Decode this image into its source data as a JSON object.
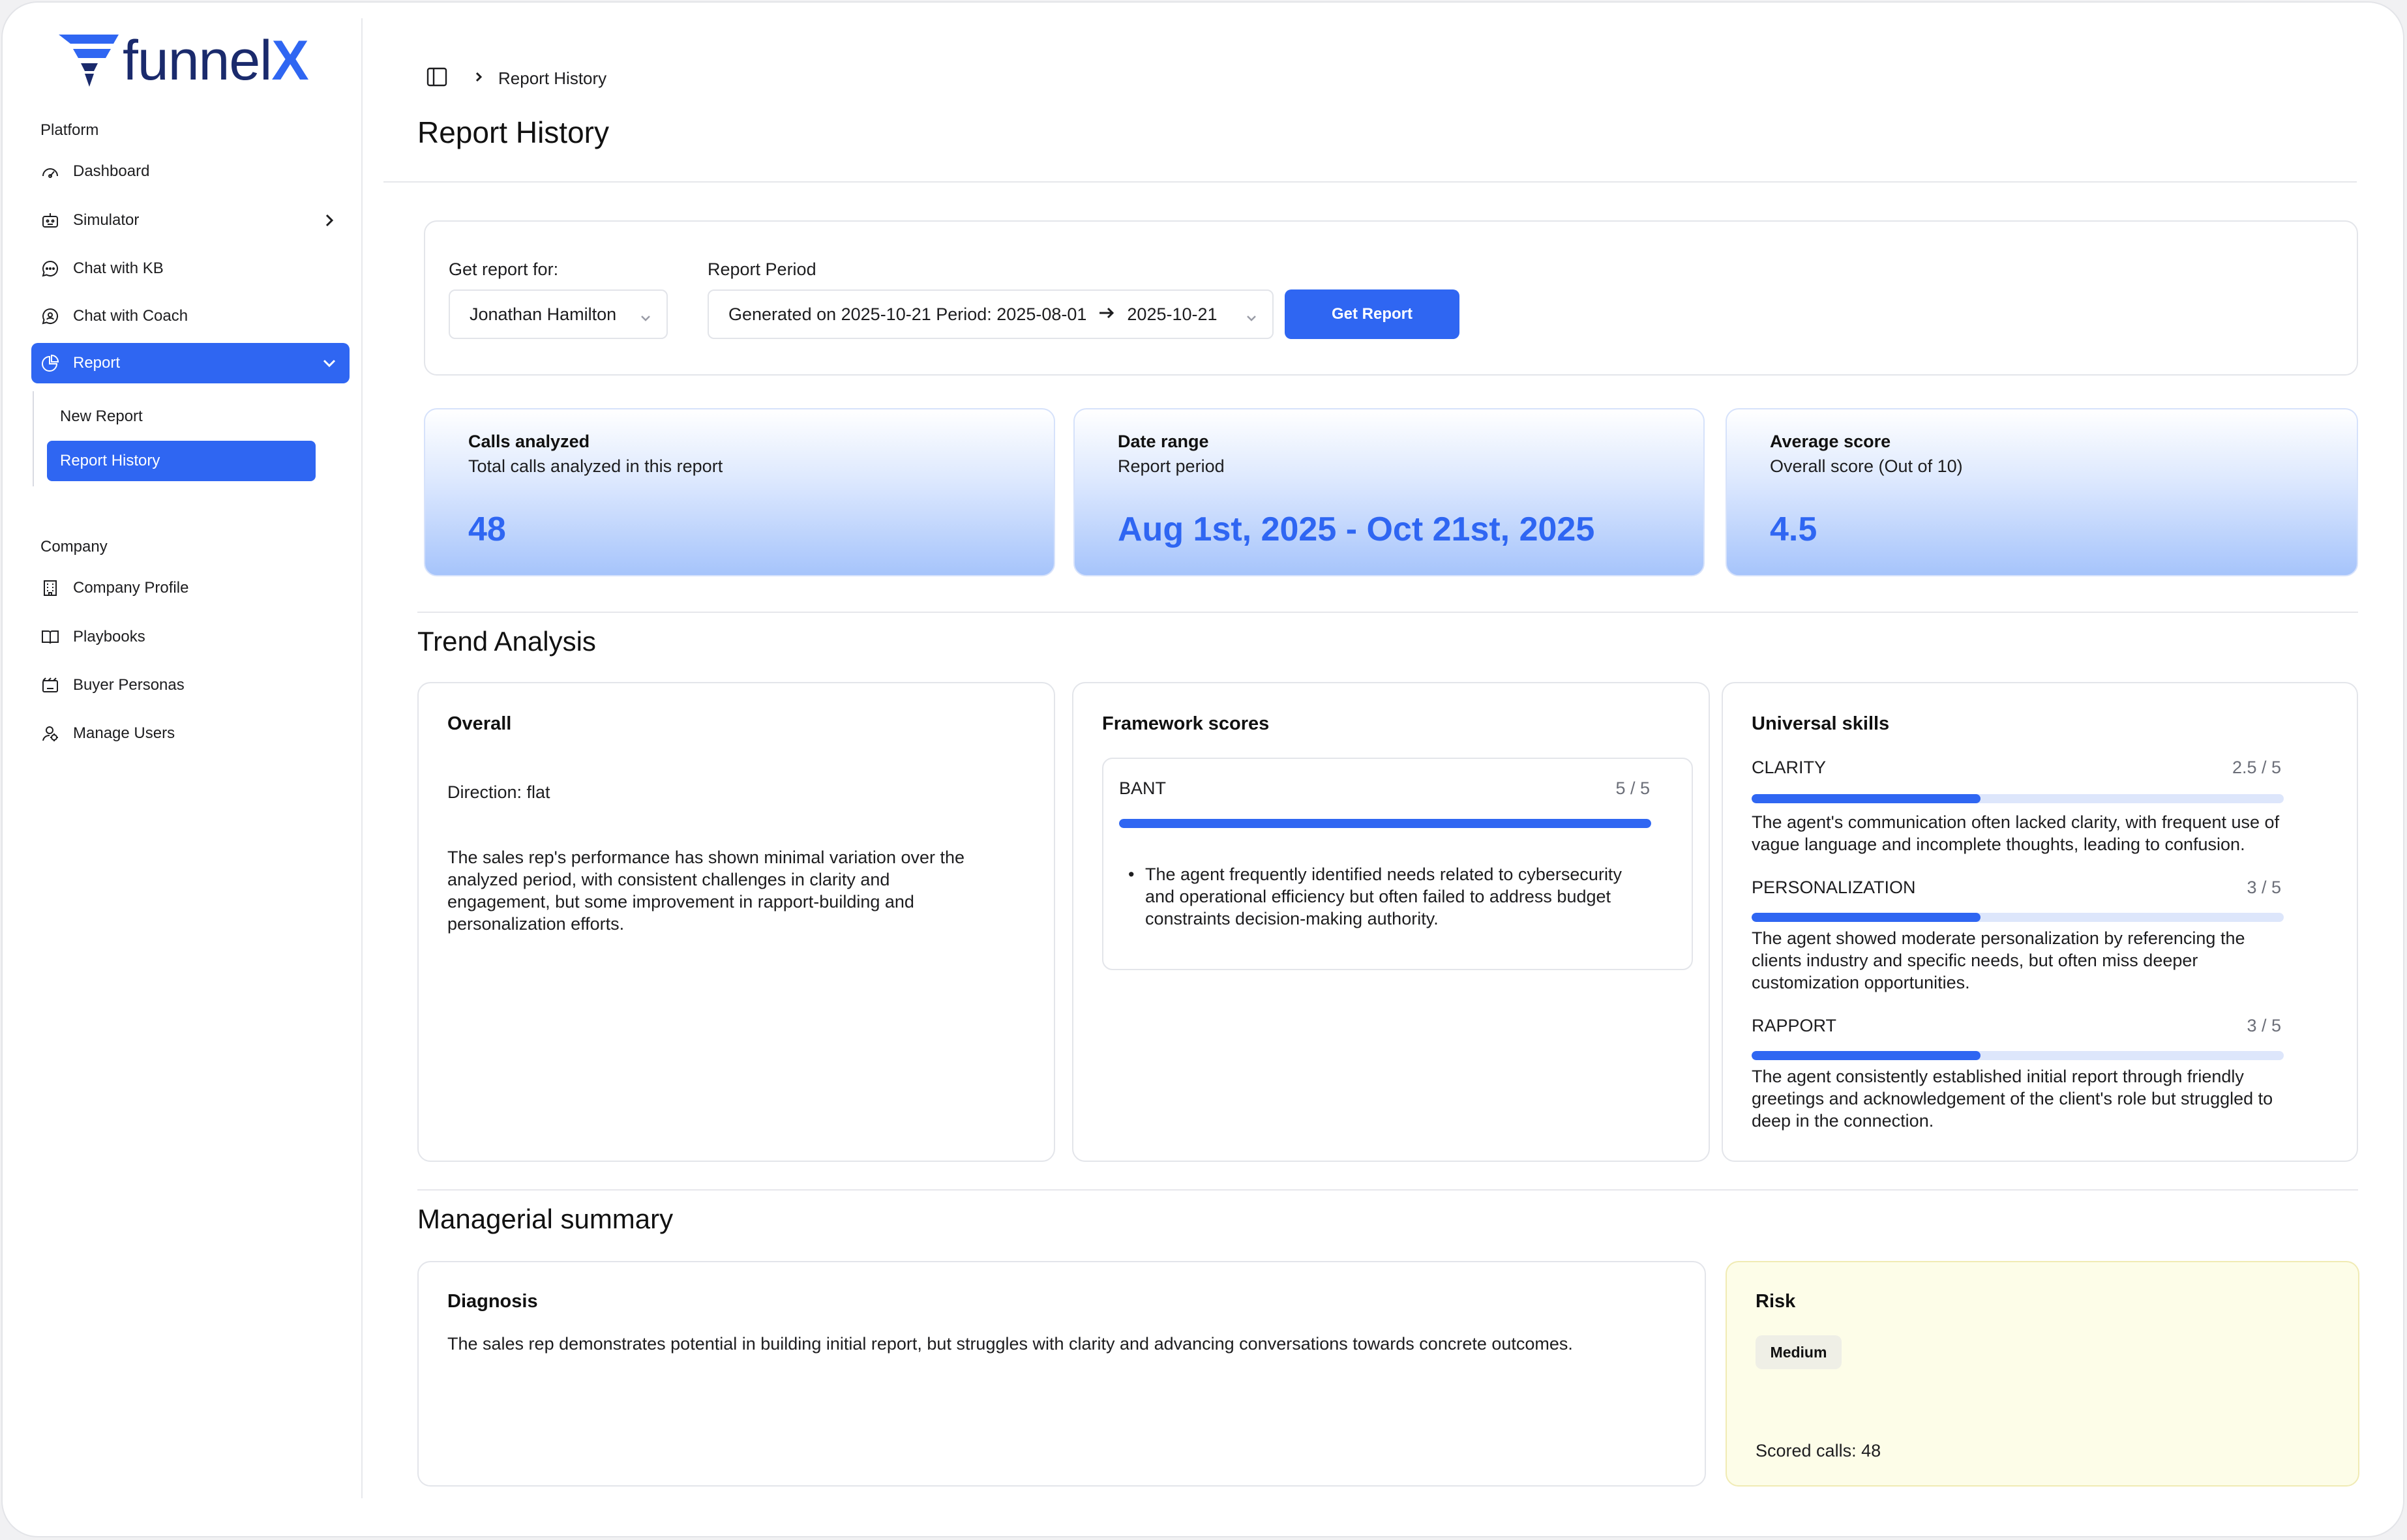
{
  "brand": {
    "name_main": "funnel",
    "name_accent": "X",
    "accent_color": "#2f66f2",
    "dark_color": "#1a2a6c"
  },
  "sidebar": {
    "platform_label": "Platform",
    "company_label": "Company",
    "platform_items": [
      {
        "label": "Dashboard",
        "icon": "gauge-icon"
      },
      {
        "label": "Simulator",
        "icon": "robot-icon"
      },
      {
        "label": "Chat with KB",
        "icon": "chat-bubble-icon"
      },
      {
        "label": "Chat with Coach",
        "icon": "coach-icon"
      },
      {
        "label": "Report",
        "icon": "pie-chart-icon"
      }
    ],
    "report_sub_items": [
      {
        "label": "New Report"
      },
      {
        "label": "Report History"
      }
    ],
    "company_items": [
      {
        "label": "Company Profile",
        "icon": "building-icon"
      },
      {
        "label": "Playbooks",
        "icon": "book-icon"
      },
      {
        "label": "Buyer Personas",
        "icon": "personas-icon"
      },
      {
        "label": "Manage Users",
        "icon": "users-icon"
      }
    ]
  },
  "header": {
    "breadcrumb": "Report History",
    "title": "Report History"
  },
  "filters": {
    "rep_label": "Get report for:",
    "rep_value": "Jonathan Hamilton",
    "period_label": "Report Period",
    "period_prefix": "Generated on 2025-10-21 Period: 2025-08-01",
    "period_end": "2025-10-21",
    "button_label": "Get Report"
  },
  "stats": [
    {
      "title": "Calls analyzed",
      "subtitle": "Total calls analyzed in this report",
      "value": "48"
    },
    {
      "title": "Date range",
      "subtitle": "Report period",
      "value": "Aug 1st, 2025 - Oct 21st, 2025"
    },
    {
      "title": "Average score",
      "subtitle": "Overall score (Out of 10)",
      "value": "4.5"
    }
  ],
  "trend": {
    "section_title": "Trend Analysis",
    "overall": {
      "title": "Overall",
      "direction": "Direction: flat",
      "text": "The sales rep's performance has shown minimal variation over the analyzed period, with consistent challenges in clarity and engagement, but some improvement in rapport-building and personalization efforts."
    },
    "framework": {
      "title": "Framework scores",
      "items": [
        {
          "name": "BANT",
          "score_text": "5 / 5",
          "fraction": 1.0,
          "bullets": [
            "The agent frequently identified needs related to cybersecurity and operational efficiency but often failed to address budget constraints decision-making authority."
          ]
        }
      ]
    },
    "skills": {
      "title": "Universal skills",
      "items": [
        {
          "name": "CLARITY",
          "score_text": "2.5 / 5",
          "fraction": 0.43,
          "text": "The agent's communication often lacked clarity, with frequent use of vague language and incomplete thoughts, leading to confusion."
        },
        {
          "name": "PERSONALIZATION",
          "score_text": "3 / 5",
          "fraction": 0.43,
          "text": "The agent showed moderate personalization by referencing the clients industry and specific needs, but often miss deeper customization opportunities."
        },
        {
          "name": "RAPPORT",
          "score_text": "3 / 5",
          "fraction": 0.43,
          "text": "The agent consistently established initial report through friendly greetings and acknowledgement of the client's role but struggled to deep in the connection."
        }
      ]
    }
  },
  "summary": {
    "section_title": "Managerial summary",
    "diagnosis": {
      "title": "Diagnosis",
      "text": "The sales rep demonstrates potential in building initial report, but struggles with clarity and advancing conversations towards concrete outcomes."
    },
    "risk": {
      "title": "Risk",
      "level": "Medium",
      "scored_calls": "Scored calls: 48"
    }
  }
}
